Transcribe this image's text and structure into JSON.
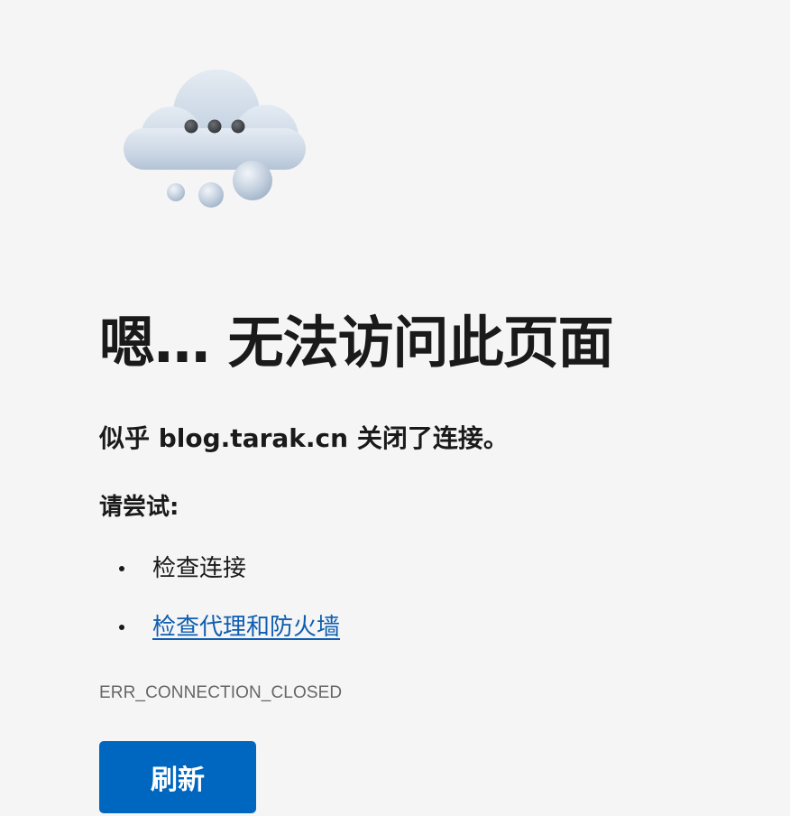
{
  "illustration": {
    "icon": "cloud-with-ellipsis-icon"
  },
  "error": {
    "title": "嗯… 无法访问此页面",
    "description": "似乎 blog.tarak.cn 关闭了连接。",
    "try_label": "请尝试:",
    "suggestions": [
      {
        "label": "检查连接",
        "is_link": false
      },
      {
        "label": "检查代理和防火墙",
        "is_link": true
      }
    ],
    "code": "ERR_CONNECTION_CLOSED"
  },
  "actions": {
    "refresh_label": "刷新"
  },
  "colors": {
    "background": "#f5f5f5",
    "link": "#0f5eb0",
    "button": "#0067c0",
    "code_text": "#666666"
  }
}
